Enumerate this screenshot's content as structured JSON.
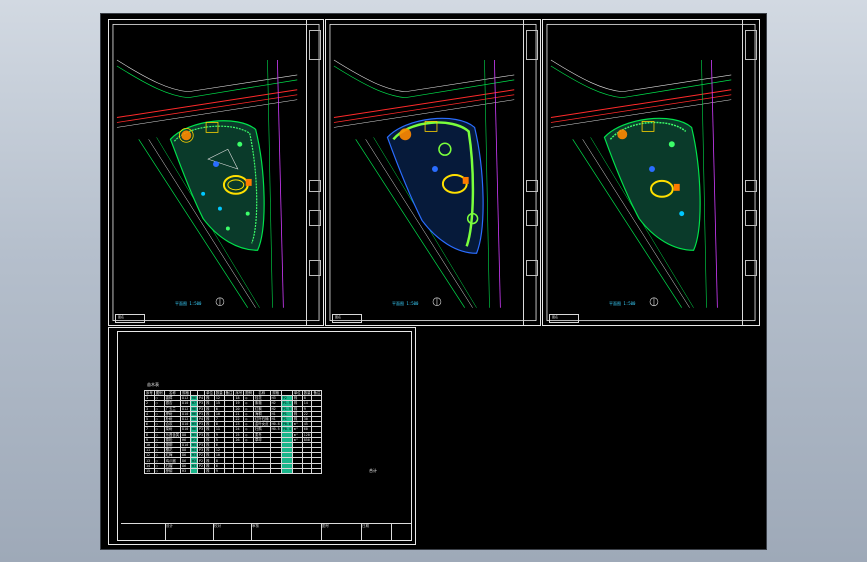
{
  "app": {
    "background_gradient": [
      "#d2d9e2",
      "#9ea9b8"
    ],
    "canvas_bg": "#000000"
  },
  "sheets": [
    {
      "name": "plan-sheet-1",
      "scale_label": "平面图 1:500",
      "stamp": "图名"
    },
    {
      "name": "plan-sheet-2",
      "scale_label": "平面图 1:500",
      "stamp": "图名"
    },
    {
      "name": "plan-sheet-3",
      "scale_label": "平面图 1:500",
      "stamp": "图名"
    }
  ],
  "schedule_sheet": {
    "caption": "苗木表",
    "headers": [
      "序号",
      "图例",
      "名称",
      "规格",
      "",
      "",
      "单位",
      "数量",
      "备注",
      "序号",
      "图例",
      "名称",
      "规格",
      "",
      "单位",
      "数量",
      "备注"
    ],
    "rows": [
      [
        "1",
        "○",
        "香樟",
        "D12",
        "H6",
        "P4",
        "株",
        "12",
        "",
        "18",
        "◎",
        "桂花",
        "H3",
        "P2",
        "株",
        "8",
        ""
      ],
      [
        "2",
        "○",
        "银杏",
        "D10",
        "H7",
        "P3",
        "株",
        "15",
        "",
        "19",
        "◎",
        "紫薇",
        "H2",
        "P1.5",
        "株",
        "14",
        ""
      ],
      [
        "3",
        "○",
        "广玉兰",
        "D12",
        "H6",
        "P3",
        "株",
        "6",
        "",
        "20",
        "◎",
        "红枫",
        "H2",
        "P1.5",
        "株",
        "9",
        ""
      ],
      [
        "4",
        "○",
        "榉树",
        "D10",
        "H6",
        "P3",
        "株",
        "10",
        "",
        "21",
        "◎",
        "海桐",
        "H1",
        "P1",
        "株",
        "22",
        ""
      ],
      [
        "5",
        "○",
        "朴树",
        "D12",
        "H6",
        "P4",
        "株",
        "7",
        "",
        "22",
        "◎",
        "红叶石楠",
        "H1",
        "P1",
        "株",
        "30",
        ""
      ],
      [
        "6",
        "○",
        "合欢",
        "D10",
        "H5",
        "P3",
        "株",
        "8",
        "",
        "23",
        "◎",
        "金叶女贞",
        "H0.8",
        "P0.6",
        "m²",
        "45",
        ""
      ],
      [
        "7",
        "○",
        "栾树",
        "D10",
        "H6",
        "P3",
        "株",
        "11",
        "",
        "24",
        "◎",
        "杜鹃",
        "H0.5",
        "P0.4",
        "m²",
        "60",
        ""
      ],
      [
        "8",
        "○",
        "乐昌含笑",
        "D8",
        "H5",
        "P3",
        "株",
        "9",
        "",
        "25",
        "◎",
        "麦冬",
        "",
        "",
        "m²",
        "120",
        ""
      ],
      [
        "9",
        "○",
        "雪松",
        "H6",
        "P3",
        "",
        "株",
        "5",
        "",
        "26",
        "◎",
        "草坪",
        "",
        "",
        "m²",
        "850",
        ""
      ],
      [
        "10",
        "○",
        "垂柳",
        "D10",
        "H5",
        "P3",
        "株",
        "6",
        "",
        "",
        "",
        "",
        "",
        "",
        "",
        "",
        ""
      ],
      [
        "11",
        "○",
        "樱花",
        "D8",
        "H4",
        "P3",
        "株",
        "12",
        "",
        "",
        "",
        "",
        "",
        "",
        "",
        "",
        ""
      ],
      [
        "12",
        "○",
        "红梅",
        "D6",
        "H3",
        "P2",
        "株",
        "10",
        "",
        "",
        "",
        "",
        "",
        "",
        "",
        "",
        ""
      ],
      [
        "13",
        "○",
        "鸡爪槭",
        "D6",
        "H3",
        "P2",
        "株",
        "8",
        "",
        "",
        "",
        "",
        "",
        "",
        "",
        "",
        ""
      ],
      [
        "14",
        "○",
        "石榴",
        "D6",
        "H3",
        "P2",
        "株",
        "6",
        "",
        "",
        "",
        "",
        "",
        "",
        "",
        "",
        ""
      ],
      [
        "15",
        "○",
        "棕榈",
        "H3",
        "",
        "",
        "株",
        "9",
        "",
        "",
        "",
        "",
        "",
        "",
        "",
        "",
        ""
      ]
    ],
    "note": "合计",
    "bottom_bar": [
      "设计",
      "校对",
      "审核",
      "图号",
      "日期"
    ]
  }
}
